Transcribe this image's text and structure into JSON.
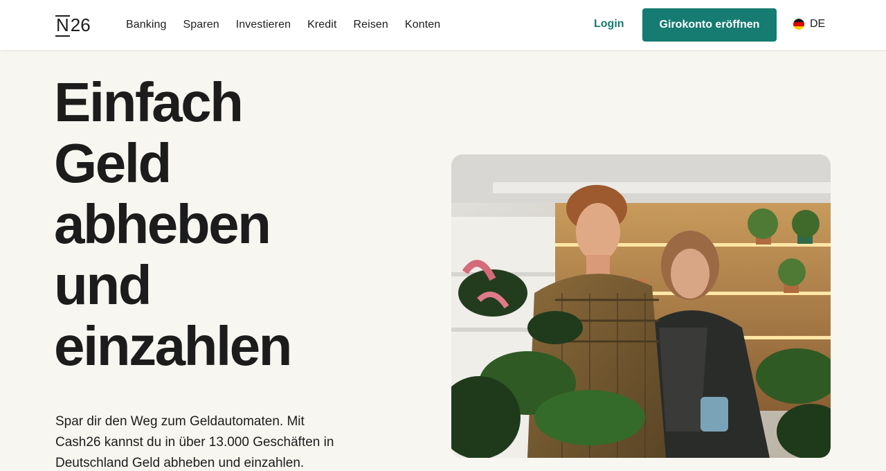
{
  "header": {
    "logo": "N26",
    "nav": [
      "Banking",
      "Sparen",
      "Investieren",
      "Kredit",
      "Reisen",
      "Konten"
    ],
    "login_label": "Login",
    "cta_label": "Girokonto eröffnen",
    "language": "DE",
    "accent_color": "#167b70"
  },
  "hero": {
    "title_lines": [
      "Einfach",
      "Geld",
      "abheben",
      "und",
      "einzahlen"
    ],
    "description_lines": [
      "Spar dir den Weg zum Geldautomaten. Mit",
      "Cash26 kannst du in über 13.000 Geschäften in",
      "Deutschland Geld abheben und einzahlen."
    ]
  },
  "icons": {
    "language_flag": "germany-flag-icon"
  }
}
